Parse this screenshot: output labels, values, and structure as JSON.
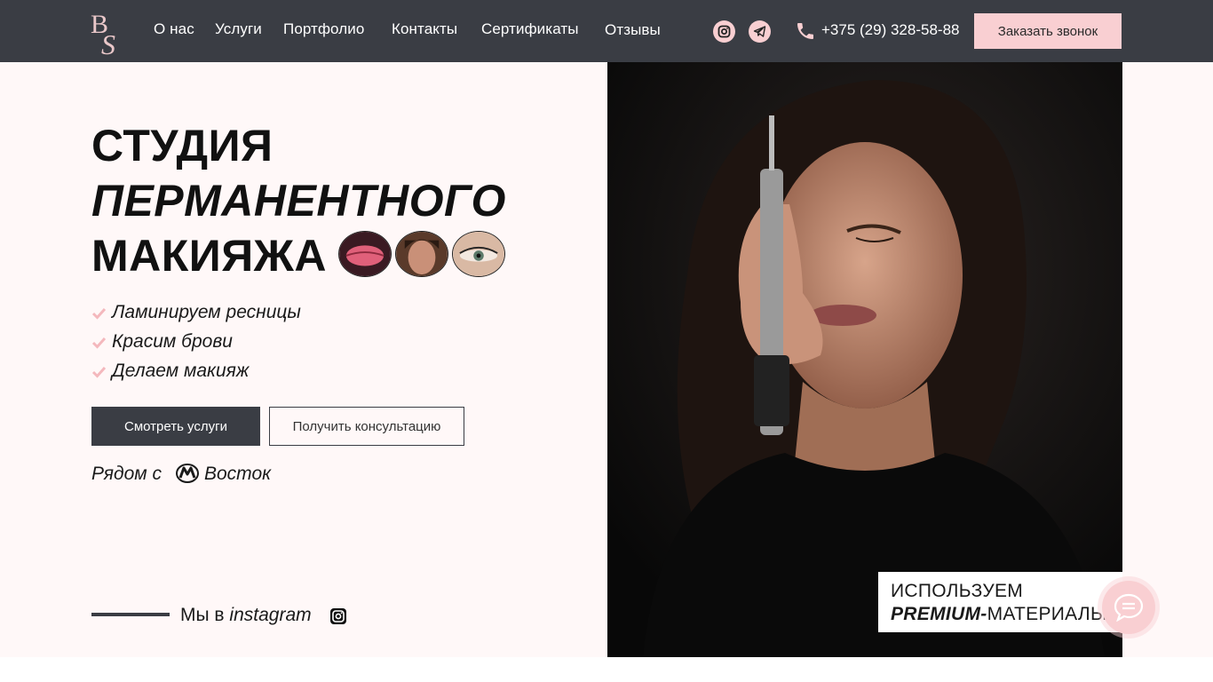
{
  "header": {
    "logo_text": "BS",
    "nav": [
      "О нас",
      "Услуги",
      "Портфолио",
      "Контакты",
      "Сертификаты",
      "Отзывы"
    ],
    "phone": "+375 (29) 328-58-88",
    "callback_label": "Заказать звонок",
    "social_icons": [
      "instagram-icon",
      "telegram-icon"
    ]
  },
  "hero": {
    "title_line1": "СТУДИЯ",
    "title_line2": "ПЕРМАНЕНТНОГО",
    "title_line3": "МАКИЯЖА",
    "features": [
      "Ламинируем ресницы",
      "Красим брови",
      "Делаем макияж"
    ],
    "btn_services": "Смотреть услуги",
    "btn_consult": "Получить консультацию",
    "metro_prefix": "Рядом с",
    "metro_station": "Восток",
    "instagram_prefix": "Мы в",
    "instagram_word": "instagram"
  },
  "badge": {
    "line1": "ИСПОЛЬЗУЕМ",
    "line2_bold": "PREMIUM-",
    "line2_rest": "МАТЕРИАЛЫ"
  },
  "colors": {
    "header_bg": "#3a3d44",
    "accent_pink": "#f9cfd2",
    "hero_bg": "#fff8f8"
  }
}
